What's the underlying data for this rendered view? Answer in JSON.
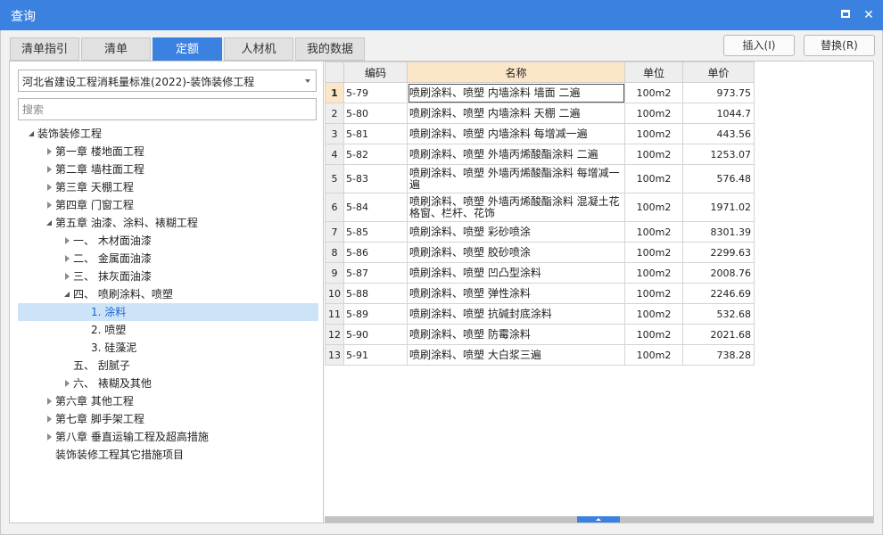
{
  "window": {
    "title": "查询"
  },
  "tabs": [
    {
      "label": "清单指引"
    },
    {
      "label": "清单"
    },
    {
      "label": "定额"
    },
    {
      "label": "人材机"
    },
    {
      "label": "我的数据"
    }
  ],
  "active_tab": "定额",
  "toolbar": {
    "insert_label": "插入(I)",
    "replace_label": "替换(R)"
  },
  "left_panel": {
    "library_select": "河北省建设工程消耗量标准(2022)-装饰装修工程",
    "search_placeholder": "搜索",
    "tree": [
      {
        "label": "装饰装修工程",
        "state": "open"
      },
      {
        "label": "第一章 楼地面工程",
        "state": "closed"
      },
      {
        "label": "第二章 墙柱面工程",
        "state": "closed"
      },
      {
        "label": "第三章 天棚工程",
        "state": "closed"
      },
      {
        "label": "第四章 门窗工程",
        "state": "closed"
      },
      {
        "label": "第五章 油漆、涂料、裱糊工程",
        "state": "open"
      },
      {
        "label": "一、 木材面油漆",
        "state": "closed"
      },
      {
        "label": "二、 金属面油漆",
        "state": "closed"
      },
      {
        "label": "三、 抹灰面油漆",
        "state": "closed"
      },
      {
        "label": "四、 喷刷涂料、喷塑",
        "state": "open"
      },
      {
        "label": "1. 涂料",
        "state": "leaf",
        "selected": true
      },
      {
        "label": "2. 喷塑",
        "state": "leaf"
      },
      {
        "label": "3. 硅藻泥",
        "state": "leaf"
      },
      {
        "label": "五、 刮腻子",
        "state": "leaf"
      },
      {
        "label": "六、 裱糊及其他",
        "state": "closed"
      },
      {
        "label": "第六章 其他工程",
        "state": "closed"
      },
      {
        "label": "第七章 脚手架工程",
        "state": "closed"
      },
      {
        "label": "第八章 垂直运输工程及超高措施",
        "state": "closed"
      },
      {
        "label": "装饰装修工程其它措施项目",
        "state": "leaf"
      }
    ]
  },
  "grid": {
    "columns": [
      "编码",
      "名称",
      "单位",
      "单价"
    ],
    "rows": [
      {
        "n": "1",
        "code": "5-79",
        "name": "喷刷涂料、喷塑 内墙涂料 墙面 二遍",
        "unit": "100m2",
        "price": "973.75"
      },
      {
        "n": "2",
        "code": "5-80",
        "name": "喷刷涂料、喷塑 内墙涂料 天棚 二遍",
        "unit": "100m2",
        "price": "1044.7"
      },
      {
        "n": "3",
        "code": "5-81",
        "name": "喷刷涂料、喷塑 内墙涂料 每增减一遍",
        "unit": "100m2",
        "price": "443.56"
      },
      {
        "n": "4",
        "code": "5-82",
        "name": "喷刷涂料、喷塑 外墙丙烯酸酯涂料 二遍",
        "unit": "100m2",
        "price": "1253.07"
      },
      {
        "n": "5",
        "code": "5-83",
        "name": "喷刷涂料、喷塑 外墙丙烯酸酯涂料 每增减一遍",
        "unit": "100m2",
        "price": "576.48"
      },
      {
        "n": "6",
        "code": "5-84",
        "name": "喷刷涂料、喷塑 外墙丙烯酸酯涂料 混凝土花格窗、栏杆、花饰",
        "unit": "100m2",
        "price": "1971.02"
      },
      {
        "n": "7",
        "code": "5-85",
        "name": "喷刷涂料、喷塑 彩砂喷涂",
        "unit": "100m2",
        "price": "8301.39"
      },
      {
        "n": "8",
        "code": "5-86",
        "name": "喷刷涂料、喷塑 胶砂喷涂",
        "unit": "100m2",
        "price": "2299.63"
      },
      {
        "n": "9",
        "code": "5-87",
        "name": "喷刷涂料、喷塑 凹凸型涂料",
        "unit": "100m2",
        "price": "2008.76"
      },
      {
        "n": "10",
        "code": "5-88",
        "name": "喷刷涂料、喷塑 弹性涂料",
        "unit": "100m2",
        "price": "2246.69"
      },
      {
        "n": "11",
        "code": "5-89",
        "name": "喷刷涂料、喷塑 抗碱封底涂料",
        "unit": "100m2",
        "price": "532.68"
      },
      {
        "n": "12",
        "code": "5-90",
        "name": "喷刷涂料、喷塑 防霉涂料",
        "unit": "100m2",
        "price": "2021.68"
      },
      {
        "n": "13",
        "code": "5-91",
        "name": "喷刷涂料、喷塑 大白浆三遍",
        "unit": "100m2",
        "price": "738.28"
      }
    ]
  },
  "icons": {
    "maximize": "maximize-icon",
    "close": "close-icon",
    "dropdown": "chevron-down-icon"
  },
  "colors": {
    "accent": "#3b82e0",
    "header_highlight": "#fce6c8",
    "tree_selection": "#cde4f8"
  }
}
